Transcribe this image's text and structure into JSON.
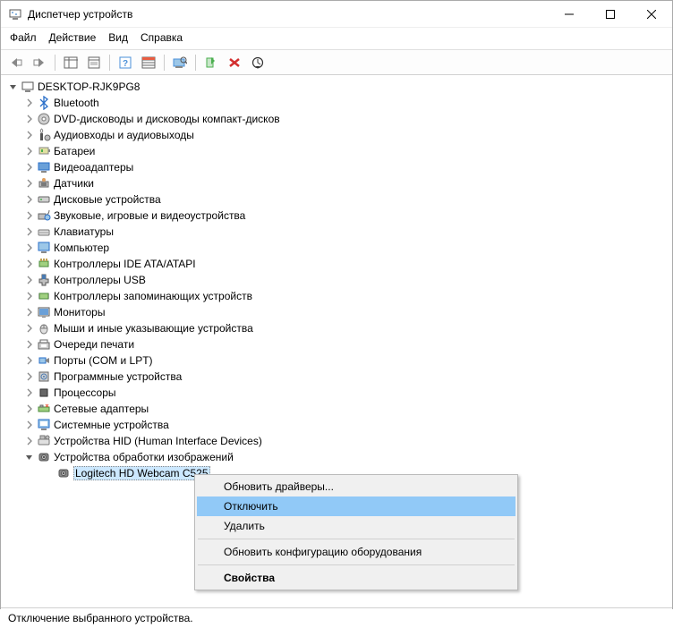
{
  "window": {
    "title": "Диспетчер устройств"
  },
  "menu": {
    "file": "Файл",
    "action": "Действие",
    "view": "Вид",
    "help": "Справка"
  },
  "tree": {
    "root": "DESKTOP-RJK9PG8",
    "items": [
      "Bluetooth",
      "DVD-дисководы и дисководы компакт-дисков",
      "Аудиовходы и аудиовыходы",
      "Батареи",
      "Видеоадаптеры",
      "Датчики",
      "Дисковые устройства",
      "Звуковые, игровые и видеоустройства",
      "Клавиатуры",
      "Компьютер",
      "Контроллеры IDE ATA/ATAPI",
      "Контроллеры USB",
      "Контроллеры запоминающих устройств",
      "Мониторы",
      "Мыши и иные указывающие устройства",
      "Очереди печати",
      "Порты (COM и LPT)",
      "Программные устройства",
      "Процессоры",
      "Сетевые адаптеры",
      "Системные устройства",
      "Устройства HID (Human Interface Devices)",
      "Устройства обработки изображений"
    ],
    "child": "Logitech HD Webcam C525"
  },
  "context": {
    "update_drivers": "Обновить драйверы...",
    "disable": "Отключить",
    "delete": "Удалить",
    "rescan": "Обновить конфигурацию оборудования",
    "properties": "Свойства"
  },
  "status": "Отключение выбранного устройства."
}
